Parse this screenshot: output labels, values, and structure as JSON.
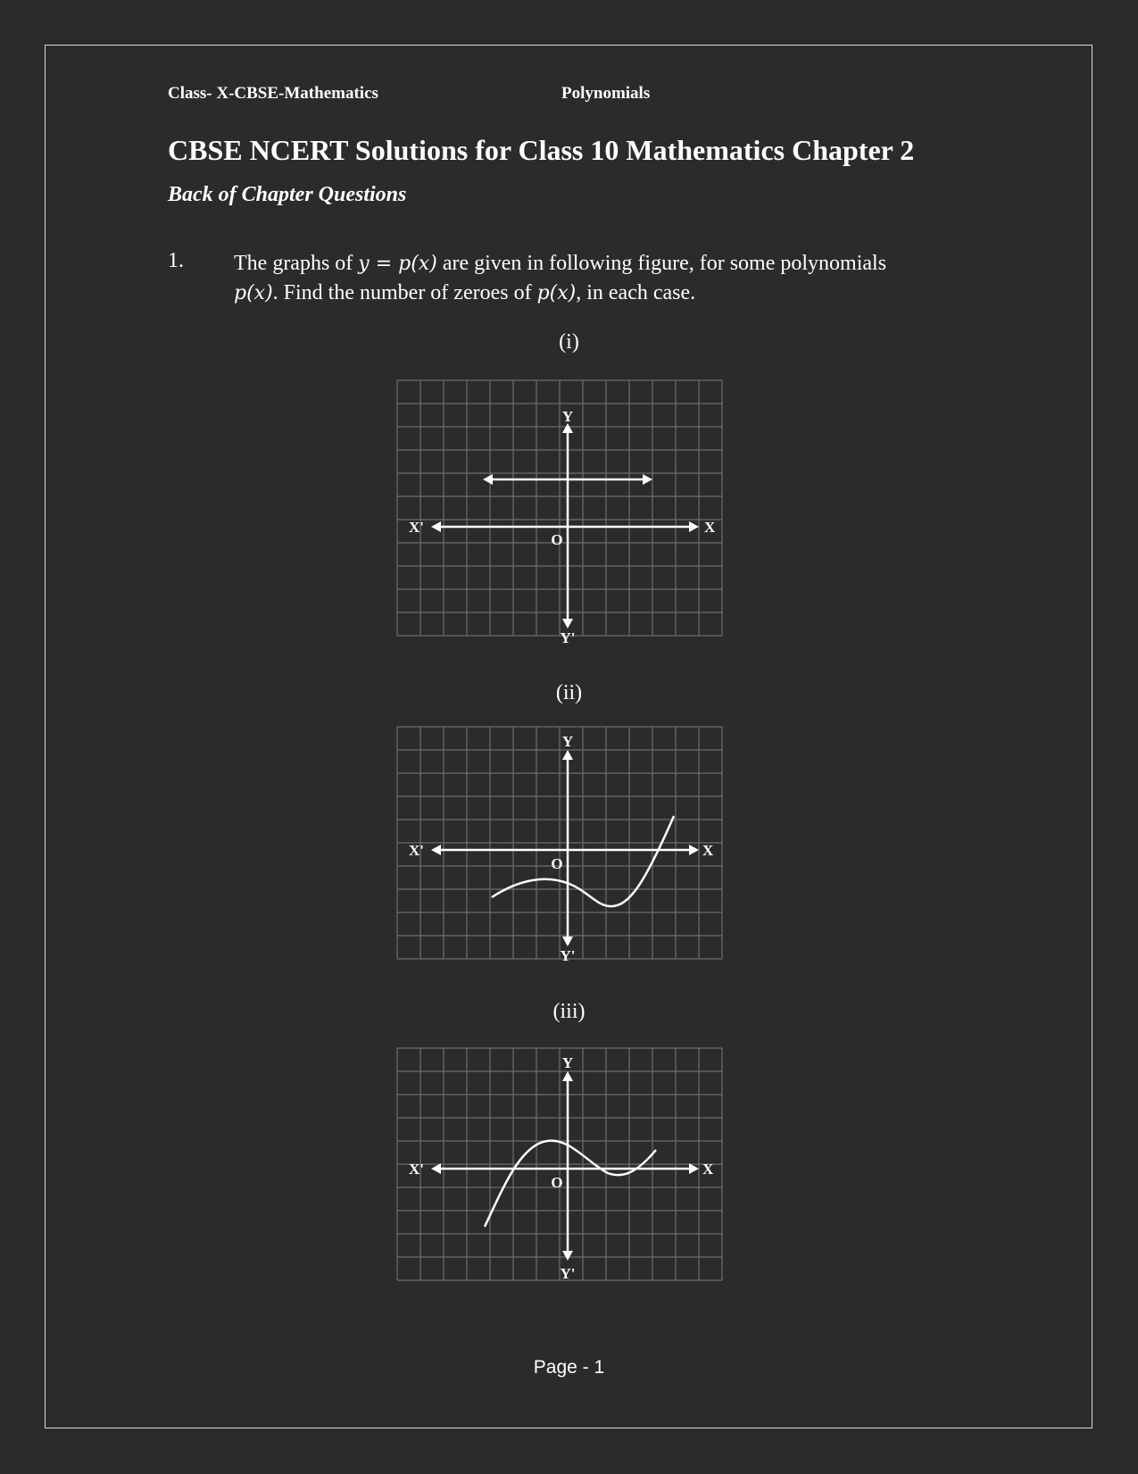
{
  "header": {
    "left": "Class- X-CBSE-Mathematics",
    "center": "Polynomials"
  },
  "title": "CBSE NCERT Solutions for Class 10 Mathematics Chapter 2",
  "subtitle": "Back of Chapter Questions",
  "question": {
    "number": "1.",
    "line1_pre": "The graphs of ",
    "line1_math": "y = p(x)",
    "line1_post": " are given in following figure, for some polynomials",
    "line2_math1": "p(x)",
    "line2_mid": ". Find the number of zeroes of ",
    "line2_math2": "p(x)",
    "line2_post": ", in each case."
  },
  "figures": [
    {
      "caption": "(i)",
      "curve": "horizontal line above x-axis",
      "labels": {
        "y": "Y",
        "y_neg": "Y'",
        "x": "X",
        "x_neg": "X'",
        "origin": "O"
      }
    },
    {
      "caption": "(ii)",
      "curve": "curve crossing x-axis once",
      "labels": {
        "y": "Y",
        "y_neg": "Y'",
        "x": "X",
        "x_neg": "X'",
        "origin": "O"
      }
    },
    {
      "caption": "(iii)",
      "curve": "curve crossing x-axis three times",
      "labels": {
        "y": "Y",
        "y_neg": "Y'",
        "x": "X",
        "x_neg": "X'",
        "origin": "O"
      }
    }
  ],
  "footer": "Page - 1",
  "colors": {
    "background": "#2b2b2b",
    "text": "#ffffff",
    "grid": "#6e6e6e",
    "border": "#d9d9d9"
  }
}
